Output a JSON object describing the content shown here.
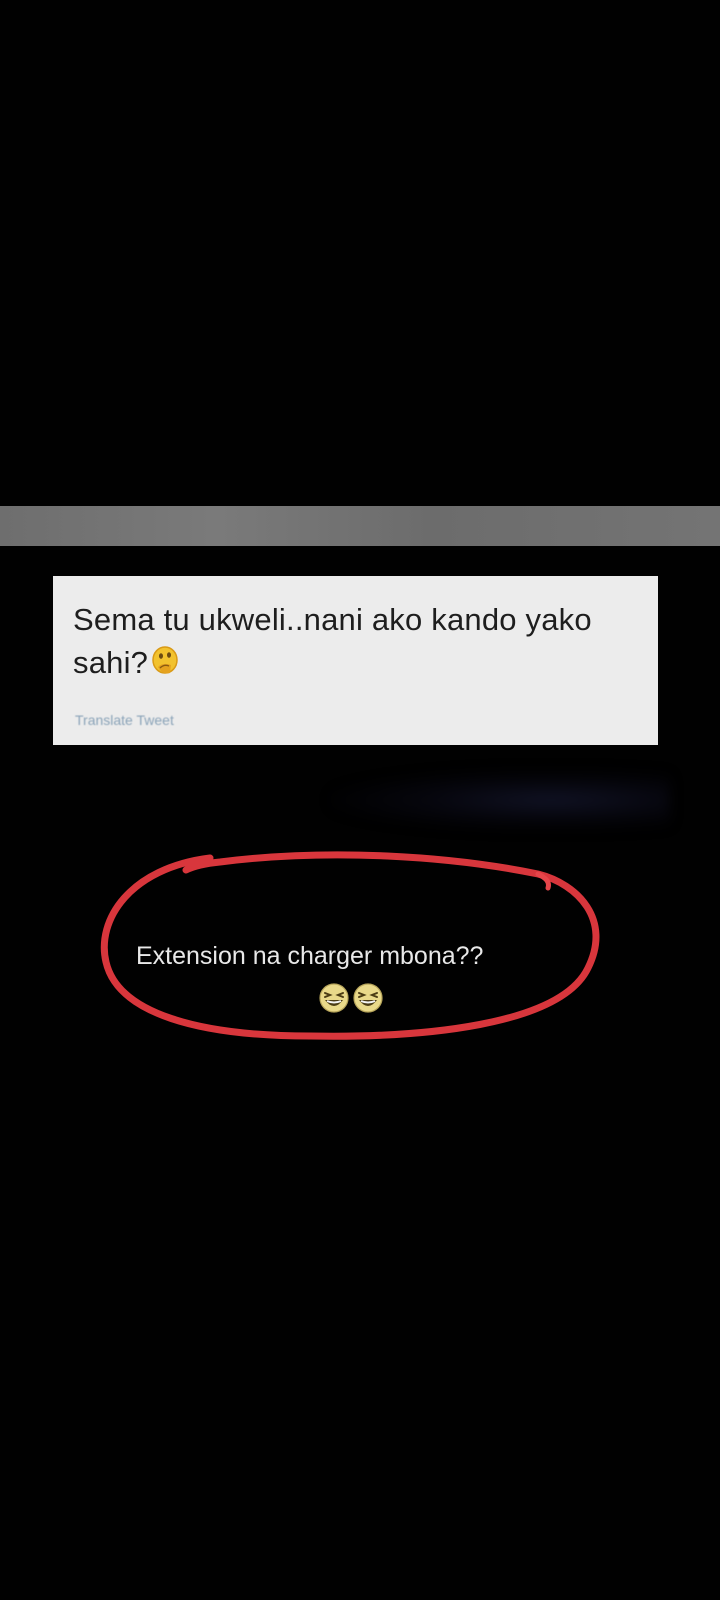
{
  "tweet": {
    "text": "Sema tu ukweli..nani ako kando yako sahi?",
    "emoji": "thinking-face-emoji",
    "translate_label": "Translate Tweet"
  },
  "reply": {
    "text": "Extension na charger mbona??",
    "emojis": [
      "grinning-squinting-face-emoji",
      "grinning-squinting-face-emoji"
    ]
  },
  "colors": {
    "background": "#010101",
    "bar": "#727272",
    "card": "#ececec",
    "circle": "#d8363c",
    "tweet_text": "#1e1e1e",
    "reply_text": "#e8e8e8"
  }
}
